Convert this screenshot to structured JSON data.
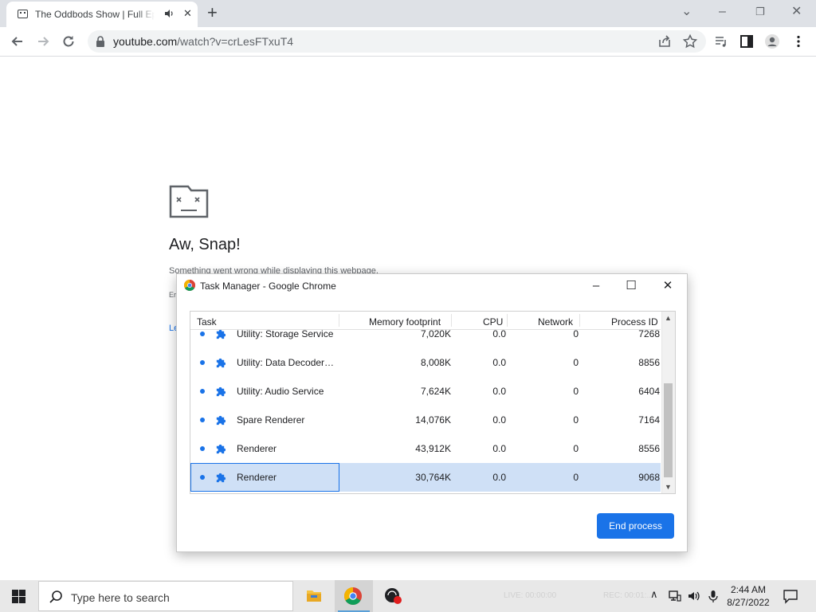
{
  "browser": {
    "tab_title": "The Oddbods Show | Full Ep",
    "new_tab_label": "+",
    "url_domain": "youtube.com",
    "url_path": "/watch?v=crLesFTxuT4"
  },
  "page": {
    "title": "Aw, Snap!",
    "message": "Something went wrong while displaying this webpage.",
    "error_code": "Er",
    "link_text": "Le"
  },
  "task_manager": {
    "title": "Task Manager - Google Chrome",
    "columns": {
      "task": "Task",
      "memory": "Memory footprint",
      "cpu": "CPU",
      "network": "Network",
      "pid": "Process ID"
    },
    "rows": [
      {
        "name": "Utility: Storage Service",
        "memory": "7,020K",
        "cpu": "0.0",
        "network": "0",
        "pid": "7268",
        "selected": false
      },
      {
        "name": "Utility: Data Decoder Service",
        "memory": "8,008K",
        "cpu": "0.0",
        "network": "0",
        "pid": "8856",
        "selected": false
      },
      {
        "name": "Utility: Audio Service",
        "memory": "7,624K",
        "cpu": "0.0",
        "network": "0",
        "pid": "6404",
        "selected": false
      },
      {
        "name": "Spare Renderer",
        "memory": "14,076K",
        "cpu": "0.0",
        "network": "0",
        "pid": "7164",
        "selected": false
      },
      {
        "name": "Renderer",
        "memory": "43,912K",
        "cpu": "0.0",
        "network": "0",
        "pid": "8556",
        "selected": false
      },
      {
        "name": "Renderer",
        "memory": "30,764K",
        "cpu": "0.0",
        "network": "0",
        "pid": "9068",
        "selected": true
      }
    ],
    "end_process_label": "End process"
  },
  "taskbar": {
    "search_placeholder": "Type here to search",
    "live_text": "LIVE: 00:00:00",
    "rec_text": "REC: 00:01:...",
    "time": "2:44 AM",
    "date": "8/27/2022"
  },
  "colors": {
    "accent": "#1a73e8",
    "selection": "#cfe0f6",
    "taskbar": "#e8e8e8"
  },
  "icons": {
    "tab_favicon": "youtube-sad-icon",
    "tab_audio": "speaker-icon",
    "back": "arrow-left-icon",
    "forward": "arrow-right-icon",
    "reload": "reload-icon",
    "lock": "lock-icon",
    "share": "share-icon",
    "bookmark": "star-icon",
    "media": "media-queue-icon",
    "side_panel": "side-panel-icon",
    "profile": "profile-icon",
    "menu": "kebab-menu-icon",
    "process": "puzzle-icon"
  }
}
